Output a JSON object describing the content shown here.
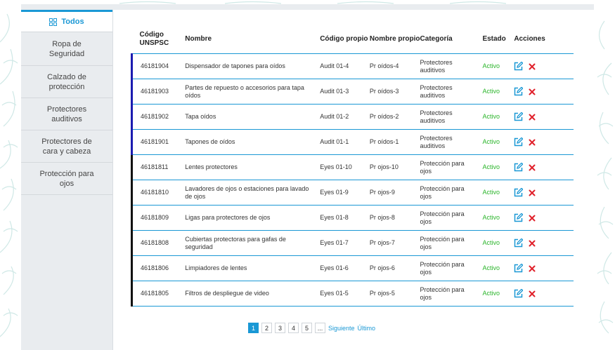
{
  "sidebar": {
    "items": [
      {
        "label": "Todos",
        "active": true
      },
      {
        "label": "Ropa de Seguridad"
      },
      {
        "label": "Calzado de protección"
      },
      {
        "label": "Protectores auditivos"
      },
      {
        "label": "Protectores de cara y cabeza"
      },
      {
        "label": "Protección para ojos"
      }
    ]
  },
  "table": {
    "headers": [
      "Código UNSPSC",
      "Nombre",
      "Código propio",
      "Nombre propio",
      "Categoría",
      "Estado",
      "Acciones"
    ],
    "rows": [
      {
        "code": "46181904",
        "name": "Dispensador de tapones para oídos",
        "own_code": "Audit 01-4",
        "own_name": "Pr oídos-4",
        "category": "Protectores auditivos",
        "status": "Activo"
      },
      {
        "code": "46181903",
        "name": "Partes de repuesto o accesorios para tapa oídos",
        "own_code": "Audit 01-3",
        "own_name": "Pr oídos-3",
        "category": "Protectores auditivos",
        "status": "Activo"
      },
      {
        "code": "46181902",
        "name": "Tapa oídos",
        "own_code": "Audit 01-2",
        "own_name": "Pr oídos-2",
        "category": "Protectores auditivos",
        "status": "Activo"
      },
      {
        "code": "46181901",
        "name": "Tapones de oídos",
        "own_code": "Audit 01-1",
        "own_name": "Pr oídos-1",
        "category": "Protectores auditivos",
        "status": "Activo"
      },
      {
        "code": "46181811",
        "name": "Lentes protectores",
        "own_code": "Eyes 01-10",
        "own_name": "Pr ojos-10",
        "category": "Protección para ojos",
        "status": "Activo"
      },
      {
        "code": "46181810",
        "name": "Lavadores de ojos o estaciones para lavado de ojos",
        "own_code": "Eyes 01-9",
        "own_name": "Pr ojos-9",
        "category": "Protección para ojos",
        "status": "Activo"
      },
      {
        "code": "46181809",
        "name": "Ligas para protectores de ojos",
        "own_code": "Eyes 01-8",
        "own_name": "Pr ojos-8",
        "category": "Protección para ojos",
        "status": "Activo"
      },
      {
        "code": "46181808",
        "name": "Cubiertas protectoras para gafas de seguridad",
        "own_code": "Eyes 01-7",
        "own_name": "Pr ojos-7",
        "category": "Protección para ojos",
        "status": "Activo"
      },
      {
        "code": "46181806",
        "name": "Limpiadores de lentes",
        "own_code": "Eyes 01-6",
        "own_name": "Pr ojos-6",
        "category": "Protección para ojos",
        "status": "Activo"
      },
      {
        "code": "46181805",
        "name": "Filtros de despliegue de video",
        "own_code": "Eyes 01-5",
        "own_name": "Pr ojos-5",
        "category": "Protección para ojos",
        "status": "Activo"
      }
    ]
  },
  "pagination": {
    "pages": [
      "1",
      "2",
      "3",
      "4",
      "5",
      "..."
    ],
    "current": "1",
    "next_label": "Siguiente",
    "last_label": "Último"
  },
  "colors": {
    "accent": "#1a98d5",
    "active_status": "#2bb52b",
    "delete": "#e0202a",
    "group_auditivos": "#1c1cb0",
    "group_ojos": "#111111"
  },
  "icons": {
    "todos": "grid-icon",
    "edit": "edit-icon",
    "delete": "delete-icon"
  }
}
